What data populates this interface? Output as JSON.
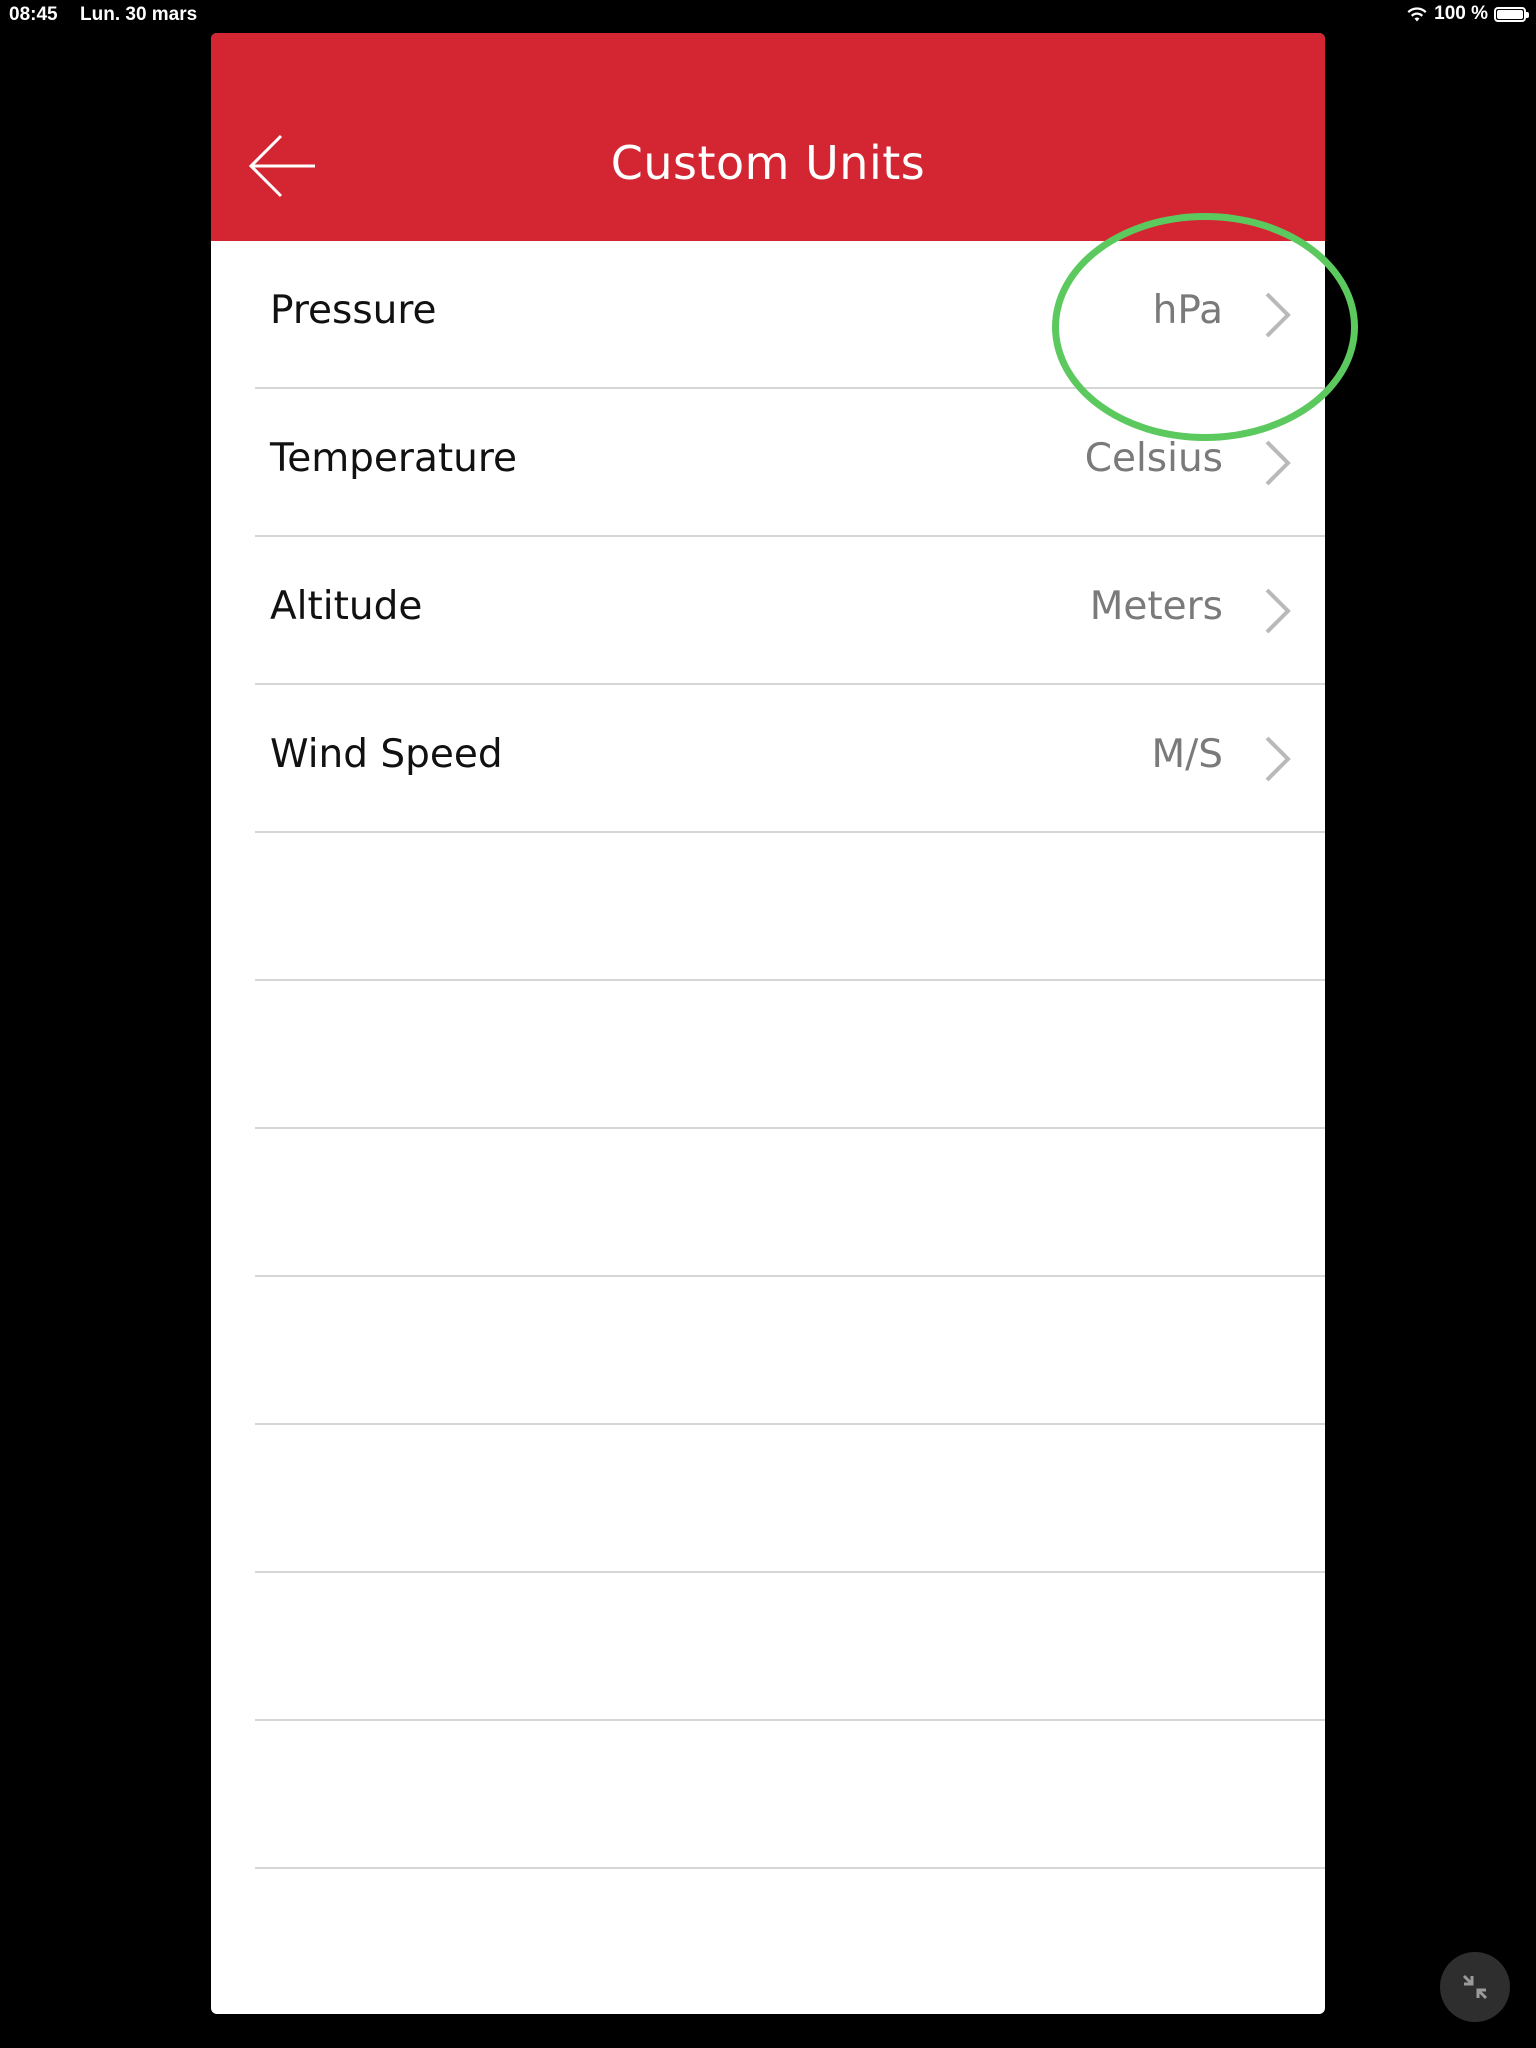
{
  "status_bar": {
    "time": "08:45",
    "date": "Lun. 30 mars",
    "battery_text": "100 %"
  },
  "header": {
    "title": "Custom Units",
    "color": "#d32632"
  },
  "settings": [
    {
      "label": "Pressure",
      "value": "hPa"
    },
    {
      "label": "Temperature",
      "value": "Celsius"
    },
    {
      "label": "Altitude",
      "value": "Meters"
    },
    {
      "label": "Wind Speed",
      "value": "M/S"
    }
  ],
  "annotation": {
    "color": "#5cc95f",
    "target": "Pressure"
  },
  "icons": {
    "back": "back-arrow-icon",
    "chevron": "chevron-right-icon",
    "wifi": "wifi-icon",
    "battery": "battery-icon",
    "minimize": "minimize-icon"
  }
}
